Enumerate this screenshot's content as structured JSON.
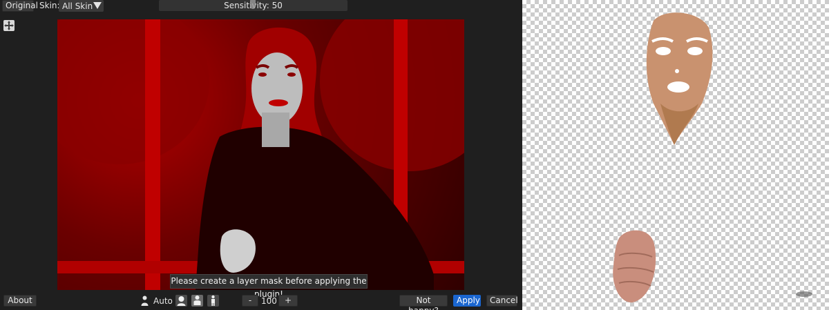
{
  "top_bar": {
    "original_label": "Original",
    "skin_label": "Skin:",
    "skin_value": "All Skin",
    "sensitivity_text": "Sensitivity: 50"
  },
  "sensitivity_value": 50,
  "tooltip": "Please create a layer mask before applying the plugin!",
  "bottom_bar": {
    "about_label": "About",
    "auto_label": "Auto",
    "minus_label": "-",
    "size_value": "100",
    "plus_label": "+",
    "not_happy_label": "Not happy?",
    "apply_label": "Apply",
    "cancel_label": "Cancel"
  },
  "colors": {
    "accent": "#1a66d0",
    "panel_bg": "#1f1f1f",
    "mask_red": "#c00000"
  },
  "icons": {
    "move": "move-icon",
    "auto": "person-icon",
    "face_mode": "face-icon",
    "bust_mode": "bust-icon",
    "body_mode": "body-icon"
  }
}
